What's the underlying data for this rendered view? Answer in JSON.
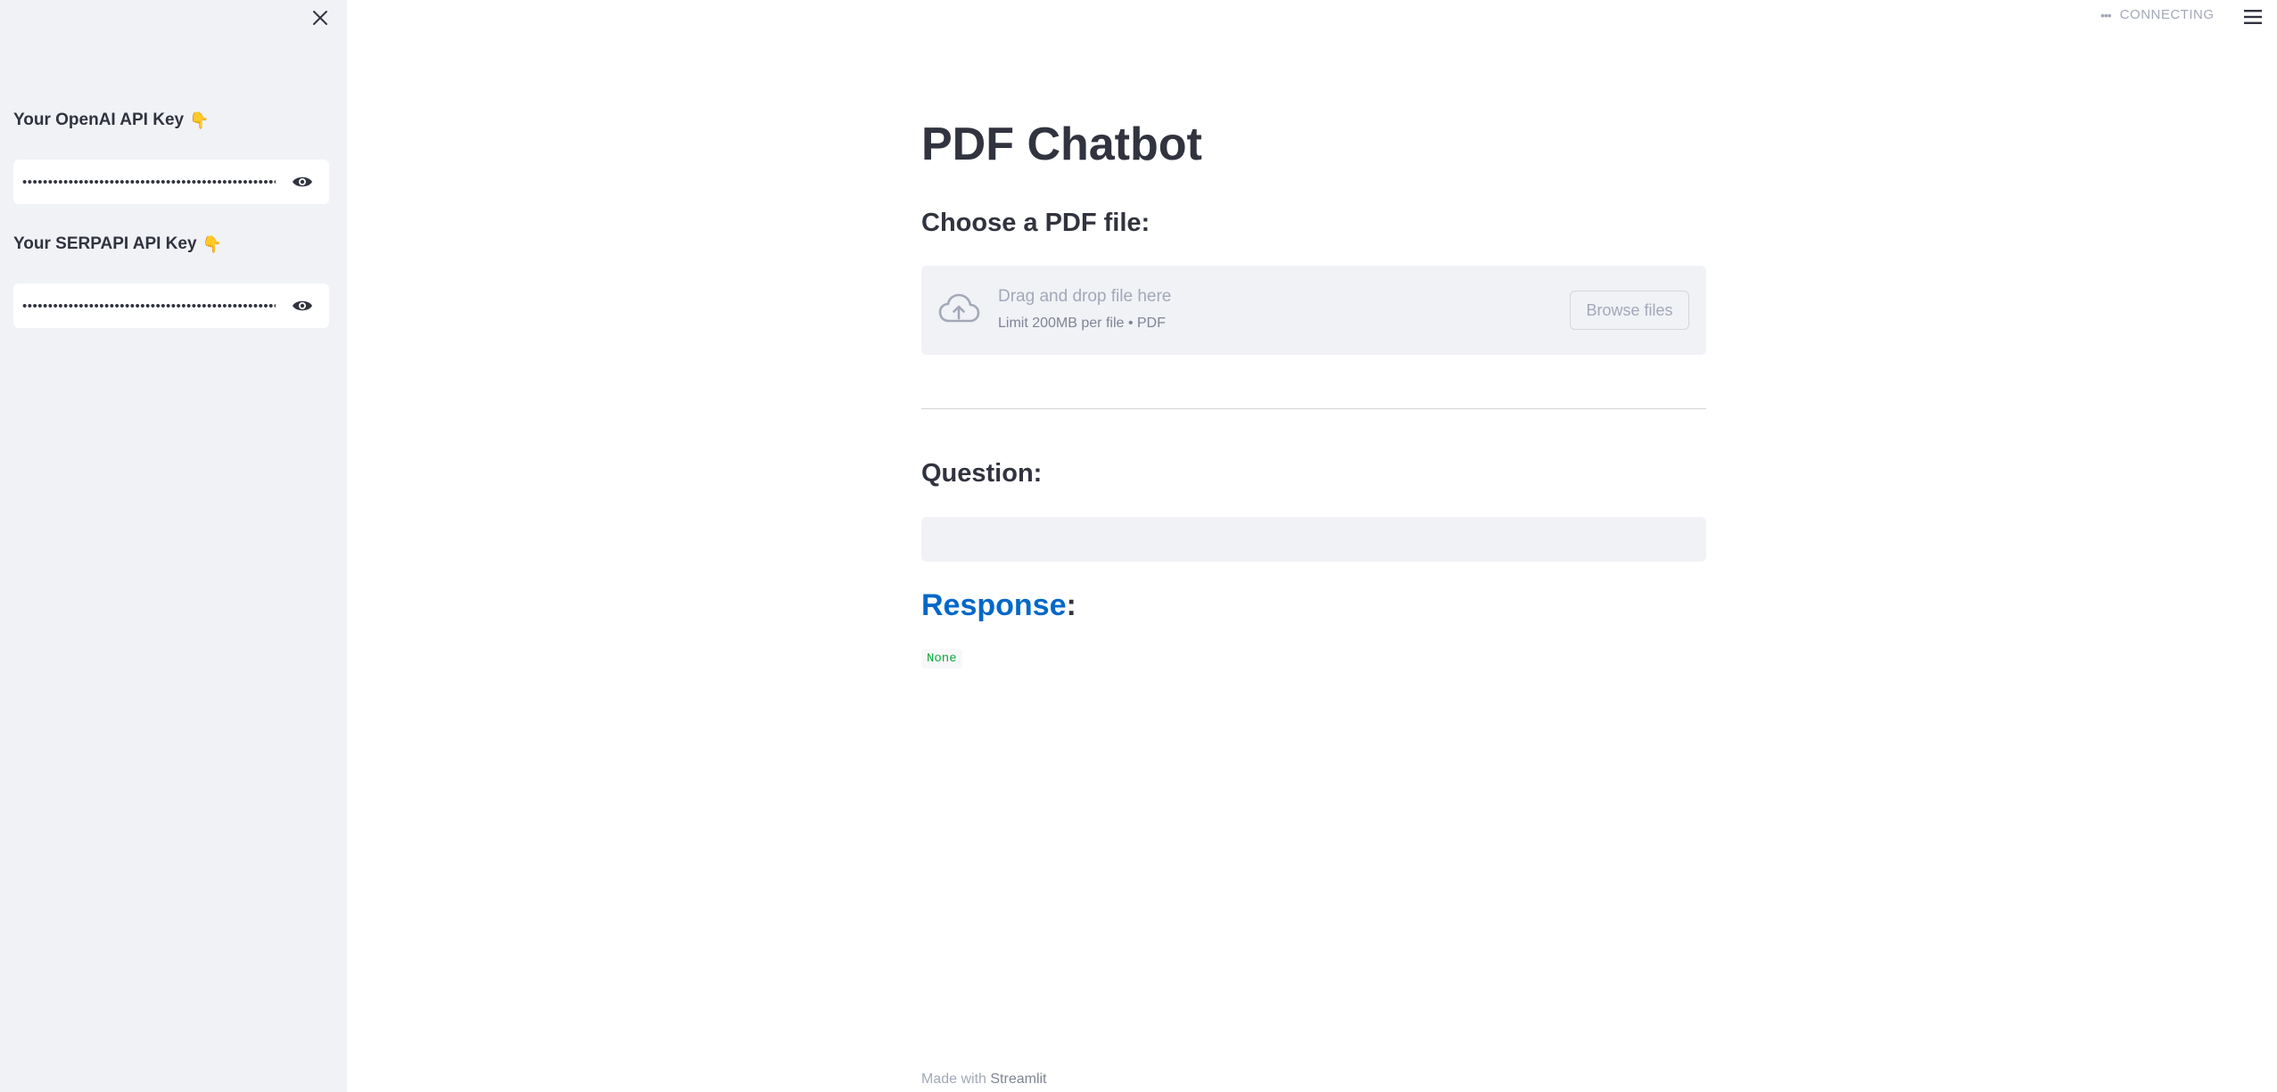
{
  "sidebar": {
    "fields": [
      {
        "label": "Your OpenAI API Key",
        "hand": "👇",
        "value": "•••••••••••••••••••••••••••••••••••••••••••••••••••"
      },
      {
        "label": "Your SERPAPI API Key",
        "hand": "👇",
        "value": "•••••••••••••••••••••••••••••••••••••••••••••••••••"
      }
    ]
  },
  "header": {
    "status": "CONNECTING"
  },
  "main": {
    "title": "PDF Chatbot",
    "upload_heading": "Choose a PDF file:",
    "uploader": {
      "title": "Drag and drop file here",
      "limit": "Limit 200MB per file • PDF",
      "browse_label": "Browse files"
    },
    "question_heading": "Question:",
    "question_value": "",
    "response_word": "Response",
    "response_colon": ":",
    "response_value": "None"
  },
  "footer": {
    "prefix": "Made with",
    "brand": "Streamlit"
  },
  "colors": {
    "sidebar_bg": "#f0f2f6",
    "accent": "#0068c9",
    "code_green": "#09ab3b",
    "text": "#31333f"
  }
}
